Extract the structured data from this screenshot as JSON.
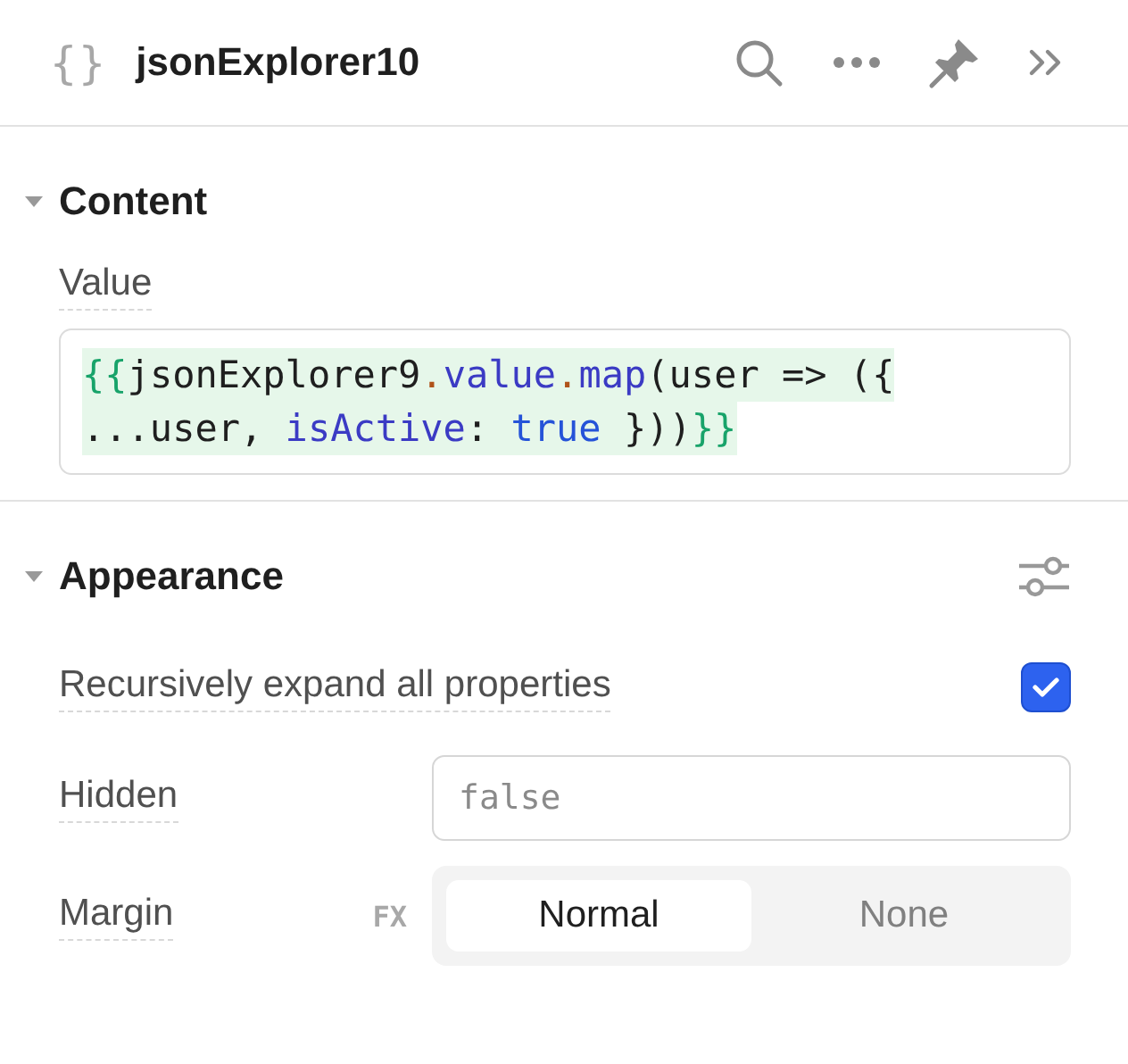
{
  "header": {
    "icon_text": "{}",
    "title": "jsonExplorer10"
  },
  "sections": [
    {
      "title": "Content",
      "expanded": true,
      "fields": [
        {
          "kind": "code",
          "label": "Value",
          "lines": [
            {
              "tokens": [
                {
                  "text": "{{",
                  "color": "#18a36a"
                },
                {
                  "text": "jsonExplorer9",
                  "color": "#1f1f1f"
                },
                {
                  "text": ".",
                  "color": "#b0531a"
                },
                {
                  "text": "value",
                  "color": "#3b3bc4"
                },
                {
                  "text": ".",
                  "color": "#b0531a"
                },
                {
                  "text": "map",
                  "color": "#3b3bc4"
                },
                {
                  "text": "(user => ({",
                  "color": "#1f1f1f"
                }
              ]
            },
            {
              "tokens": [
                {
                  "text": "...user, ",
                  "color": "#1f1f1f"
                },
                {
                  "text": "isActive",
                  "color": "#3b3bc4"
                },
                {
                  "text": ": ",
                  "color": "#1f1f1f"
                },
                {
                  "text": "true",
                  "color": "#2553d8"
                },
                {
                  "text": " }))",
                  "color": "#1f1f1f"
                },
                {
                  "text": "}}",
                  "color": "#18a36a"
                }
              ]
            }
          ]
        }
      ]
    },
    {
      "title": "Appearance",
      "expanded": true,
      "settings_icon": true,
      "fields": [
        {
          "kind": "checkbox",
          "label": "Recursively expand all properties",
          "checked": true
        },
        {
          "kind": "input",
          "label": "Hidden",
          "placeholder": "false"
        },
        {
          "kind": "segmented",
          "label": "Margin",
          "fx": "FX",
          "options": [
            {
              "label": "Normal",
              "selected": true
            },
            {
              "label": "None",
              "selected": false
            }
          ]
        }
      ]
    }
  ]
}
